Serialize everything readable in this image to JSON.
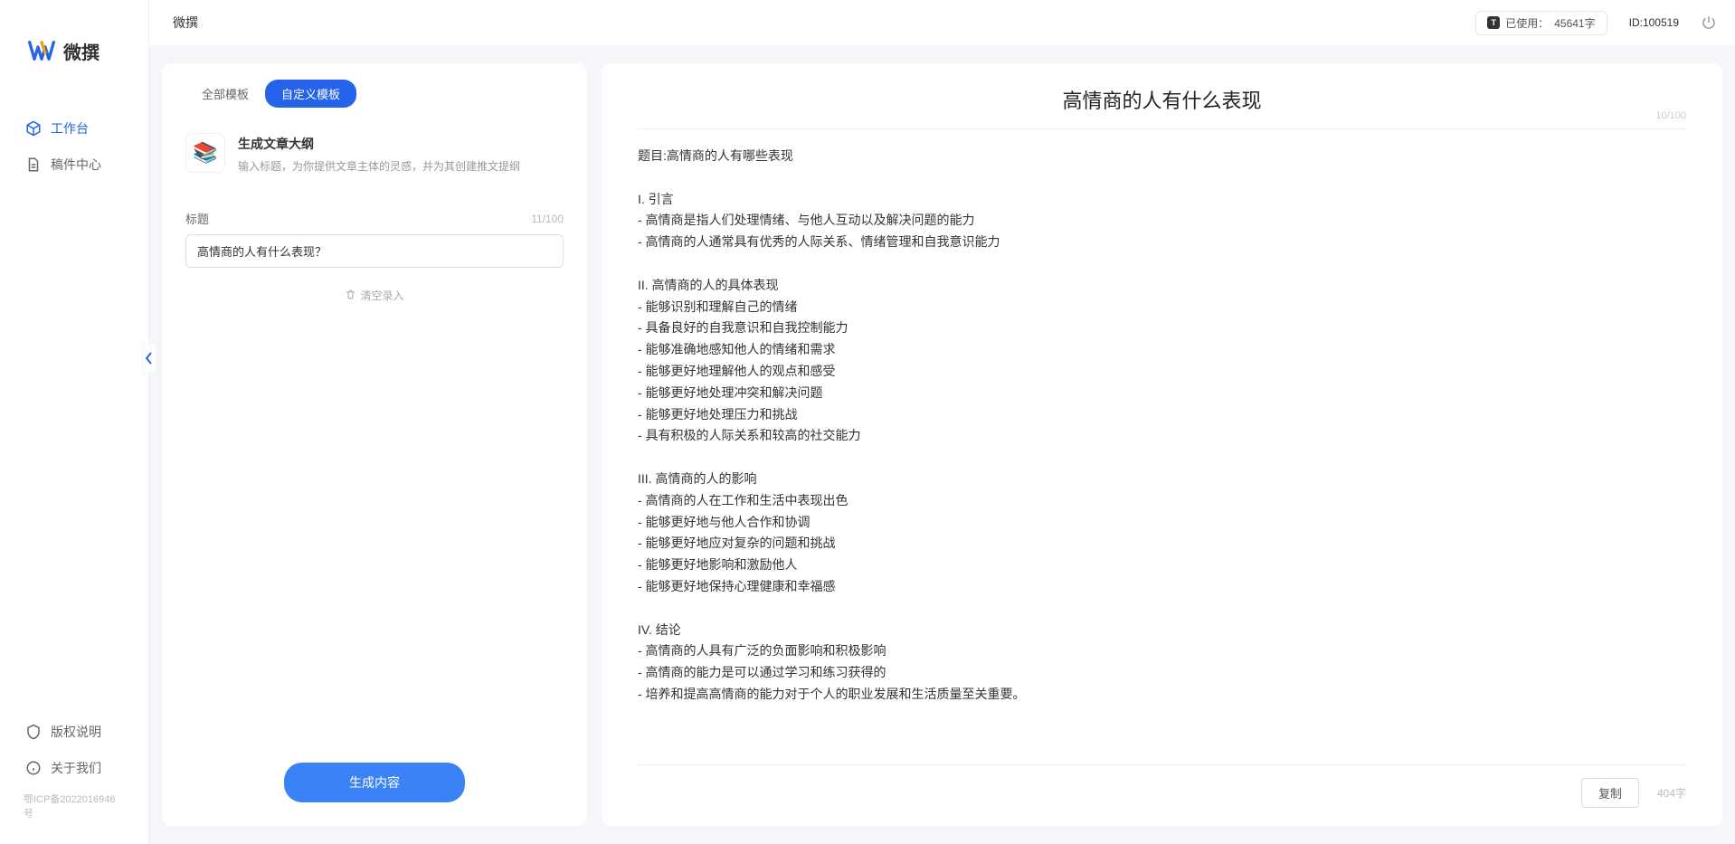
{
  "app": {
    "name": "微撰",
    "logo_text": "微撰"
  },
  "sidebar": {
    "items": [
      {
        "label": "工作台",
        "active": true
      },
      {
        "label": "稿件中心",
        "active": false
      }
    ],
    "bottom_items": [
      {
        "label": "版权说明"
      },
      {
        "label": "关于我们"
      }
    ],
    "icp": "鄂ICP备2022016946号"
  },
  "topbar": {
    "title": "微撰",
    "usage_icon": "T",
    "usage_label": "已使用：",
    "usage_value": "45641字",
    "id_label": "ID:100519"
  },
  "left_panel": {
    "tabs": [
      {
        "label": "全部模板",
        "active": false
      },
      {
        "label": "自定义模板",
        "active": true
      }
    ],
    "template": {
      "icon": "📚",
      "title": "生成文章大纲",
      "desc": "输入标题，为你提供文章主体的灵感，并为其创建推文提纲"
    },
    "form": {
      "label": "标题",
      "char_count": "11/100",
      "input_value": "高情商的人有什么表现？"
    },
    "clear_label": "清空录入",
    "generate_label": "生成内容"
  },
  "right_panel": {
    "title": "高情商的人有什么表现",
    "title_count": "10/100",
    "body": "题目:高情商的人有哪些表现\n\nI. 引言\n- 高情商是指人们处理情绪、与他人互动以及解决问题的能力\n- 高情商的人通常具有优秀的人际关系、情绪管理和自我意识能力\n\nII. 高情商的人的具体表现\n- 能够识别和理解自己的情绪\n- 具备良好的自我意识和自我控制能力\n- 能够准确地感知他人的情绪和需求\n- 能够更好地理解他人的观点和感受\n- 能够更好地处理冲突和解决问题\n- 能够更好地处理压力和挑战\n- 具有积极的人际关系和较高的社交能力\n\nIII. 高情商的人的影响\n- 高情商的人在工作和生活中表现出色\n- 能够更好地与他人合作和协调\n- 能够更好地应对复杂的问题和挑战\n- 能够更好地影响和激励他人\n- 能够更好地保持心理健康和幸福感\n\nIV. 结论\n- 高情商的人具有广泛的负面影响和积极影响\n- 高情商的能力是可以通过学习和练习获得的\n- 培养和提高高情商的能力对于个人的职业发展和生活质量至关重要。",
    "copy_label": "复制",
    "word_count": "404字"
  }
}
